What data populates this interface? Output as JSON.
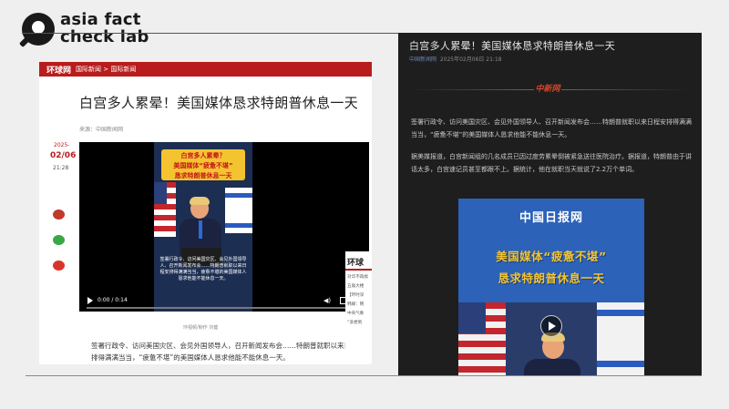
{
  "brand": {
    "line1": "asia fact",
    "line2": "check lab"
  },
  "left_article": {
    "site_brand": "环球网",
    "breadcrumb": "国际新闻 > 国际新闻",
    "title": "白宫多人累晕！美国媒体恳求特朗普休息一天",
    "source": "来源：中国新闻网",
    "date_year": "2025-",
    "date_md": "02/06",
    "date_time": "21:28",
    "video": {
      "banner_line1": "白宫多人累晕？",
      "banner_line2": "美国媒体“疲惫不堪”",
      "banner_line3": "恳求特朗普休息一天",
      "subtitle": "签署行政令、访问美国灾区、会见外国领导人、召开新闻发布会……特朗普就职以来日程安排得满满当当，疲惫不堪的美国媒体人恳求他能不能休息一天。",
      "time": "0:00 / 0:14",
      "volume_icon": "volume-icon",
      "more_icon": "more-options-icon"
    },
    "caption": "环视频/制作 刘健",
    "paragraph": "签署行政令、访问美国灾区、会见外国领导人，召开新闻发布会……特朗普就职以来日程安排得满满当当，“疲惫不堪”的美国媒体人恳求他能不能休息一天。",
    "sidebar": {
      "heading": "环球",
      "lines": [
        "对华不再搞",
        "五角大楼",
        "【环时深",
        "韩媒：韩",
        "中央气象",
        "“没想到"
      ]
    }
  },
  "right_article": {
    "title": "白宫多人累晕！美国媒体恳求特朗普休息一天",
    "source": "中国新闻网",
    "datetime": "2025年02月06日 21:18",
    "emblem": "中新网",
    "p1": "签署行政令、访问美国灾区、会见外国领导人、召开新闻发布会……特朗普就职以来日程安排得满满当当，“疲惫不堪”的美国媒体人恳求他能不能休息一天。",
    "p2": "据美媒报道，白宫新闻组的几名成员已因过度劳累晕倒被紧急送往医院治疗。据报道，特朗普由于讲话太多，白宫速记员甚至都跟不上。据统计，他在就职当天就说了2.2万个单词。",
    "image": {
      "logo": "中国日报网",
      "headline1": "美国媒体“疲惫不堪”",
      "headline2": "恳求特朗普休息一天"
    }
  },
  "colors": {
    "accent_red": "#b81c1c",
    "dark_bg": "#1e1e1e",
    "banner_yellow": "#f4c430",
    "image_blue": "#2c62b8"
  }
}
